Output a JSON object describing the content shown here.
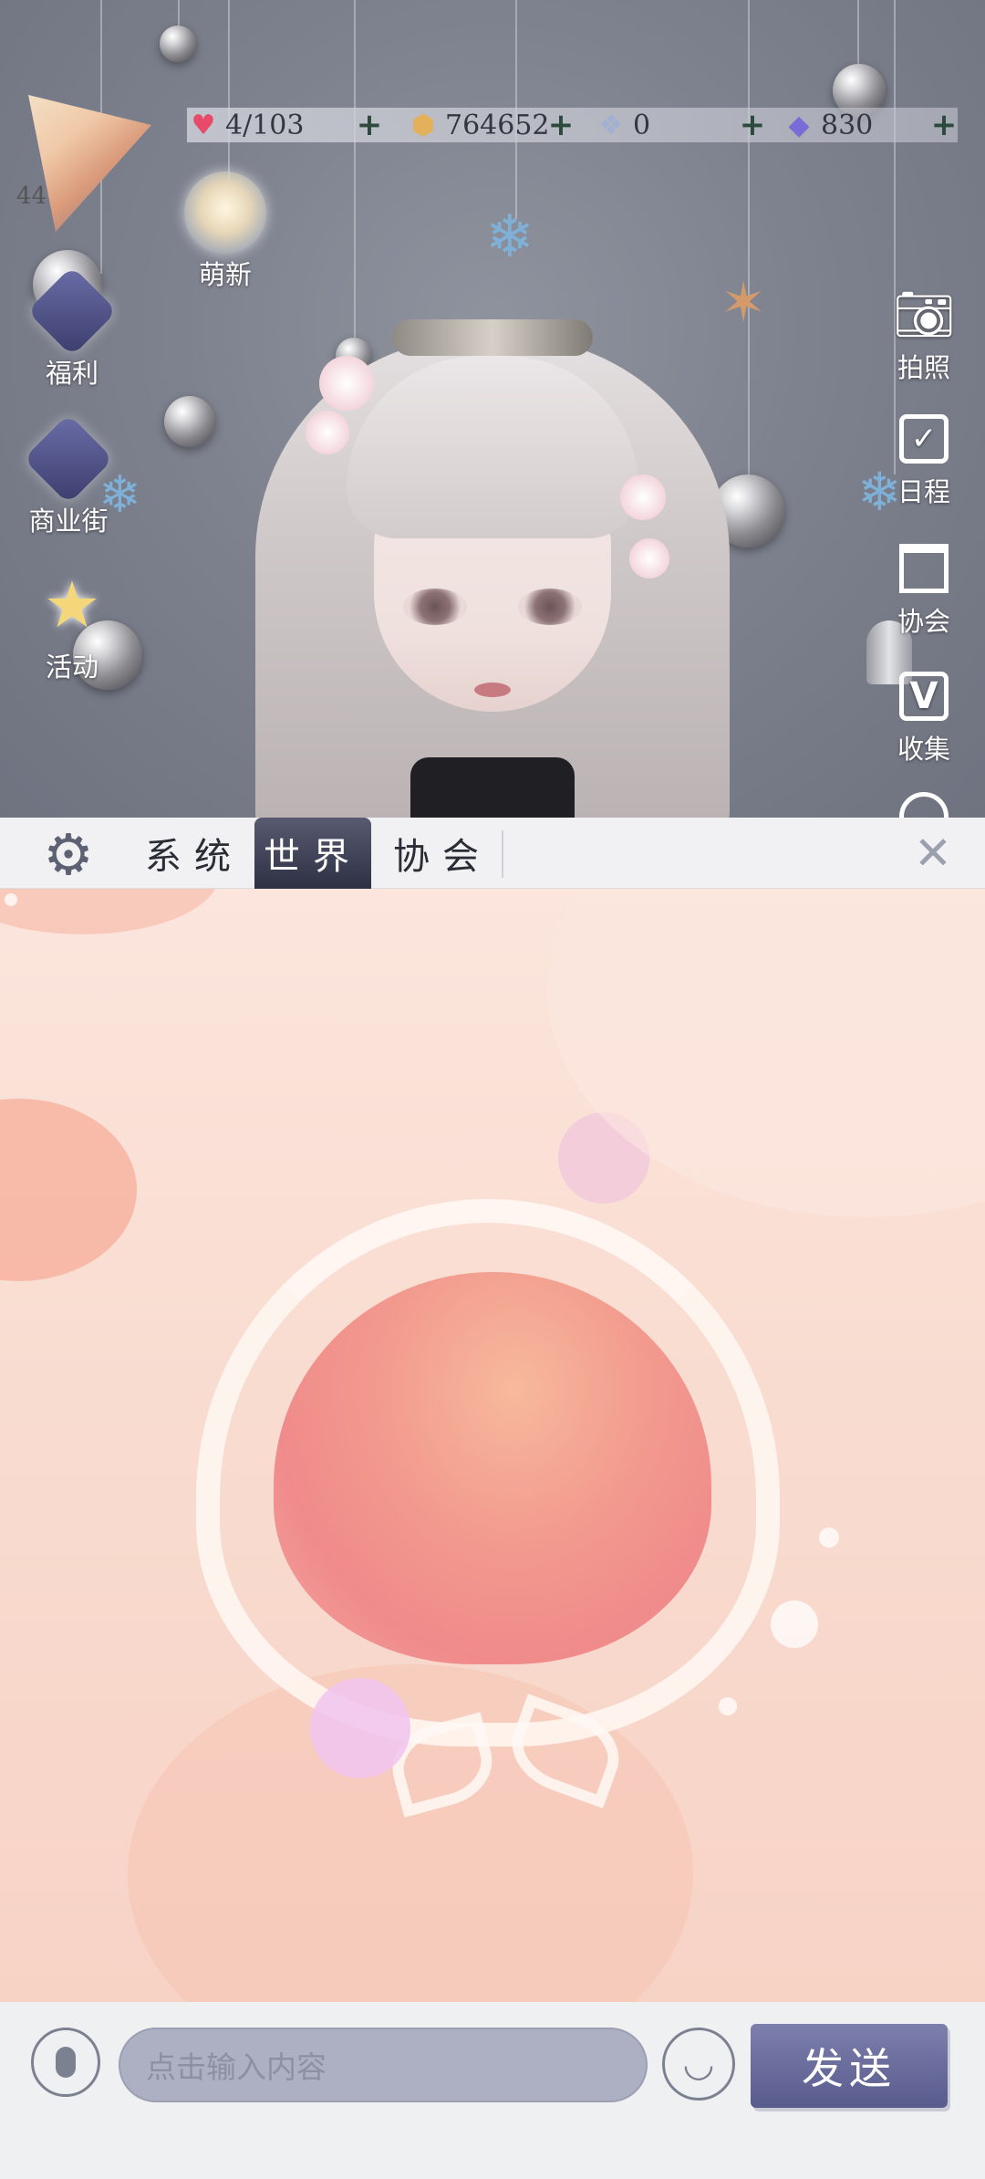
{
  "top_bar": {
    "player_level": "44",
    "stamina": "4/103",
    "coins": "764652",
    "crystals": "0",
    "diamonds": "830"
  },
  "left_menu": {
    "newbie": "萌新",
    "welfare": "福利",
    "shop_street": "商业街",
    "events": "活动"
  },
  "right_menu": {
    "photo": "拍照",
    "schedule": "日程",
    "guild": "协会",
    "collection": "收集"
  },
  "chat_tabs": {
    "system": "系统",
    "world": "世界",
    "guild": "协会",
    "active": "world"
  },
  "chat_input": {
    "placeholder": "点击输入内容",
    "send_label": "发送"
  },
  "colors": {
    "accent": "#585b8c",
    "tab_active": "#2e3044",
    "chat_bg": "#f9dcd0",
    "heart": "#e84a6a",
    "coin": "#e3b15a",
    "diamond": "#7a6cd6"
  }
}
